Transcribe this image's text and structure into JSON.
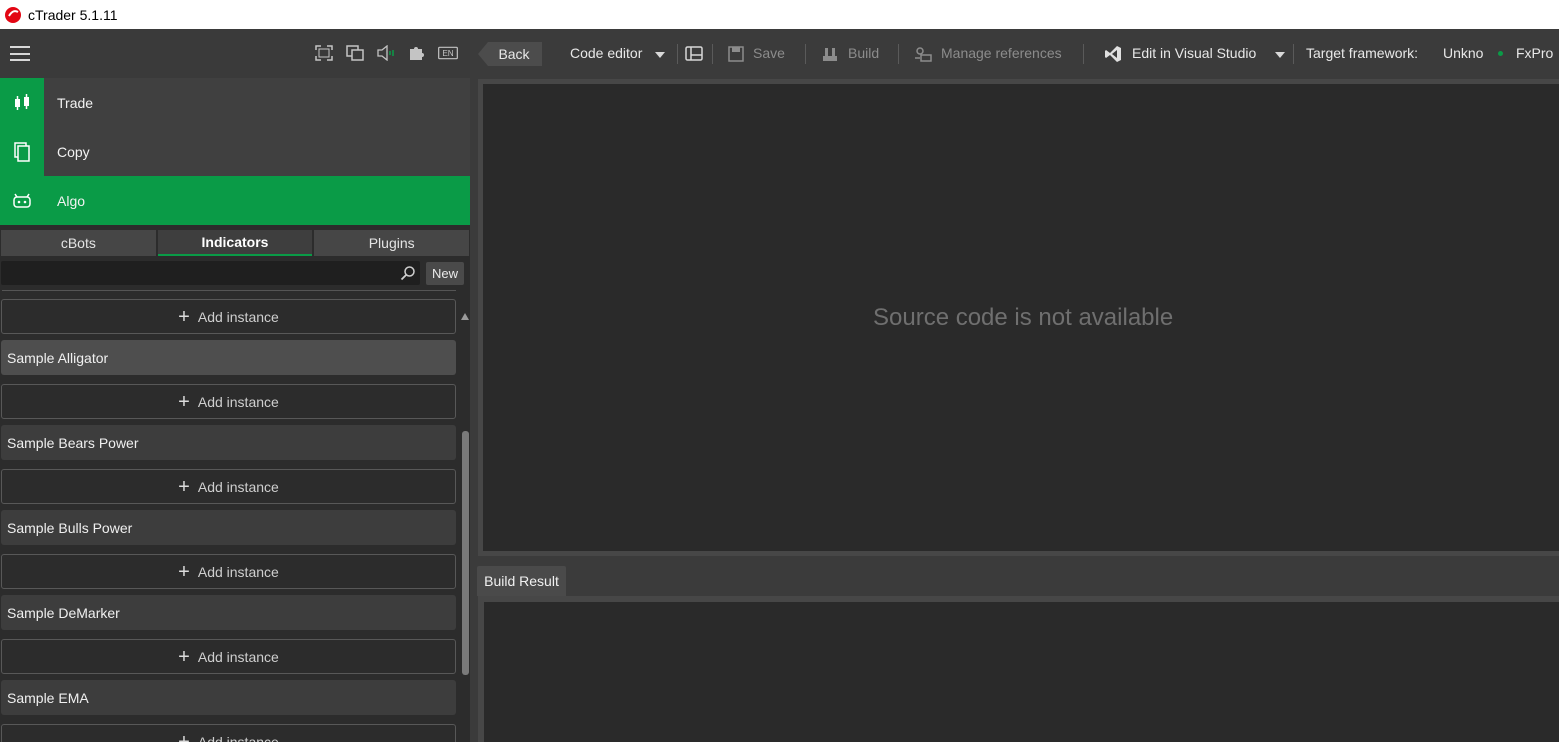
{
  "app": {
    "title": "cTrader 5.1.11"
  },
  "topbar": {
    "icons": [
      "fullscreen-icon",
      "windows-icon",
      "sound-icon",
      "plugin-icon",
      "language-icon"
    ],
    "language": "EN"
  },
  "nav": {
    "trade": "Trade",
    "copy": "Copy",
    "algo": "Algo"
  },
  "tabs": {
    "cbots": "cBots",
    "indicators": "Indicators",
    "plugins": "Plugins"
  },
  "search": {
    "placeholder": "",
    "new_label": "New"
  },
  "list": {
    "add_instance": "Add instance",
    "items": [
      "Sample Alligator",
      "Sample Bears Power",
      "Sample Bulls Power",
      "Sample DeMarker",
      "Sample EMA"
    ]
  },
  "toolbar": {
    "back": "Back",
    "code_editor": "Code editor",
    "save": "Save",
    "build": "Build",
    "manage_references": "Manage references",
    "edit_in_vs": "Edit in Visual Studio",
    "target_framework_label": "Target framework:",
    "target_framework_value": "Unkno",
    "broker": "FxPro"
  },
  "editor": {
    "message": "Source code is not available"
  },
  "build": {
    "tab_label": "Build Result"
  },
  "colors": {
    "accent": "#0a9b47",
    "background": "#2b2b2b"
  }
}
